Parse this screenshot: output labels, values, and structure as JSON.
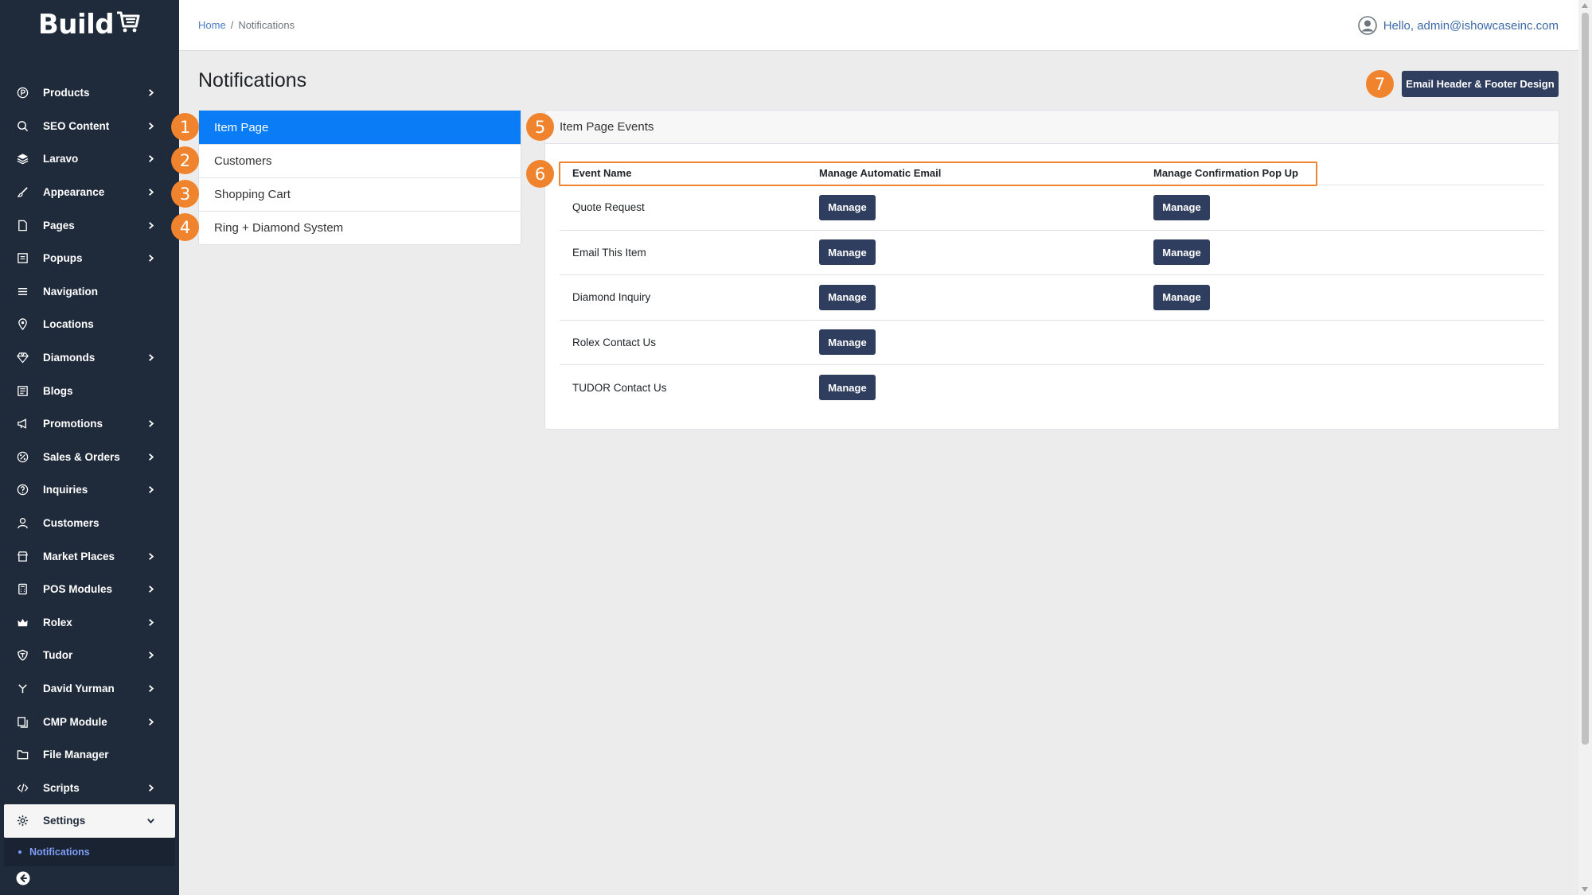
{
  "app": {
    "logo_text": "Build"
  },
  "sidebar": {
    "items": [
      {
        "label": "Products",
        "icon": "products-icon",
        "has_children": true
      },
      {
        "label": "SEO Content",
        "icon": "seo-icon",
        "has_children": true
      },
      {
        "label": "Laravo",
        "icon": "layers-icon",
        "has_children": true
      },
      {
        "label": "Appearance",
        "icon": "brush-icon",
        "has_children": true
      },
      {
        "label": "Pages",
        "icon": "page-icon",
        "has_children": true
      },
      {
        "label": "Popups",
        "icon": "popup-icon",
        "has_children": true
      },
      {
        "label": "Navigation",
        "icon": "menu-icon",
        "has_children": false
      },
      {
        "label": "Locations",
        "icon": "location-pin-icon",
        "has_children": false
      },
      {
        "label": "Diamonds",
        "icon": "diamond-icon",
        "has_children": true
      },
      {
        "label": "Blogs",
        "icon": "blog-icon",
        "has_children": false
      },
      {
        "label": "Promotions",
        "icon": "megaphone-icon",
        "has_children": true
      },
      {
        "label": "Sales & Orders",
        "icon": "sales-icon",
        "has_children": true
      },
      {
        "label": "Inquiries",
        "icon": "question-icon",
        "has_children": true
      },
      {
        "label": "Customers",
        "icon": "user-icon",
        "has_children": false
      },
      {
        "label": "Market Places",
        "icon": "store-icon",
        "has_children": true
      },
      {
        "label": "POS Modules",
        "icon": "pos-icon",
        "has_children": true
      },
      {
        "label": "Rolex",
        "icon": "crown-icon",
        "has_children": true
      },
      {
        "label": "Tudor",
        "icon": "shield-icon",
        "has_children": true
      },
      {
        "label": "David Yurman",
        "icon": "dy-icon",
        "has_children": true
      },
      {
        "label": "CMP Module",
        "icon": "cmp-icon",
        "has_children": true
      },
      {
        "label": "File Manager",
        "icon": "folder-icon",
        "has_children": false
      },
      {
        "label": "Scripts",
        "icon": "code-icon",
        "has_children": true
      }
    ],
    "active": {
      "label": "Settings",
      "icon": "gear-icon"
    },
    "sub_item": "Notifications"
  },
  "header": {
    "breadcrumb": {
      "home": "Home",
      "separator": "/",
      "current": "Notifications"
    },
    "greeting": "Hello, admin@ishowcaseinc.com"
  },
  "page": {
    "title": "Notifications",
    "email_design_button": "Email Header & Footer Design"
  },
  "tabs": [
    "Item Page",
    "Customers",
    "Shopping Cart",
    "Ring + Diamond System"
  ],
  "card": {
    "title": "Item Page Events",
    "columns": [
      "Event Name",
      "Manage Automatic Email",
      "Manage Confirmation Pop Up"
    ],
    "rows": [
      {
        "name": "Quote Request",
        "email_btn": "Manage",
        "popup_btn": "Manage"
      },
      {
        "name": "Email This Item",
        "email_btn": "Manage",
        "popup_btn": "Manage"
      },
      {
        "name": "Diamond Inquiry",
        "email_btn": "Manage",
        "popup_btn": "Manage"
      },
      {
        "name": "Rolex Contact Us",
        "email_btn": "Manage",
        "popup_btn": null
      },
      {
        "name": "TUDOR Contact Us",
        "email_btn": "Manage",
        "popup_btn": null
      }
    ]
  },
  "annotations": [
    "1",
    "2",
    "3",
    "4",
    "5",
    "6",
    "7"
  ],
  "colors": {
    "sidebar_bg": "#1f2a3a",
    "accent": "#0a7cf5",
    "button": "#2f3e5e",
    "annotation": "#f0832d"
  }
}
